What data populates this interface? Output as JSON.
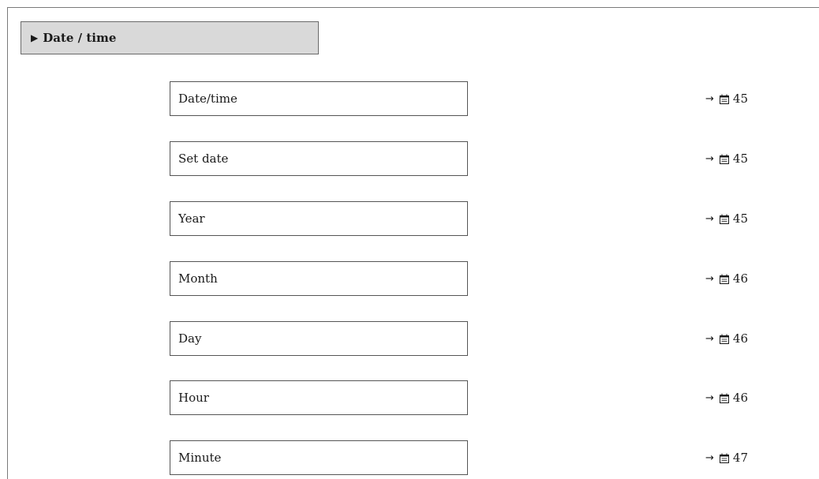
{
  "header": {
    "title": "Date / time",
    "icon": "triangle-right-icon"
  },
  "parameters": [
    {
      "label": "Date/time",
      "ref_arrow": "→",
      "ref_page": "45"
    },
    {
      "label": "Set date",
      "ref_arrow": "→",
      "ref_page": "45"
    },
    {
      "label": "Year",
      "ref_arrow": "→",
      "ref_page": "45"
    },
    {
      "label": "Month",
      "ref_arrow": "→",
      "ref_page": "46"
    },
    {
      "label": "Day",
      "ref_arrow": "→",
      "ref_page": "46"
    },
    {
      "label": "Hour",
      "ref_arrow": "→",
      "ref_page": "46"
    },
    {
      "label": "Minute",
      "ref_arrow": "→",
      "ref_page": "47"
    }
  ]
}
